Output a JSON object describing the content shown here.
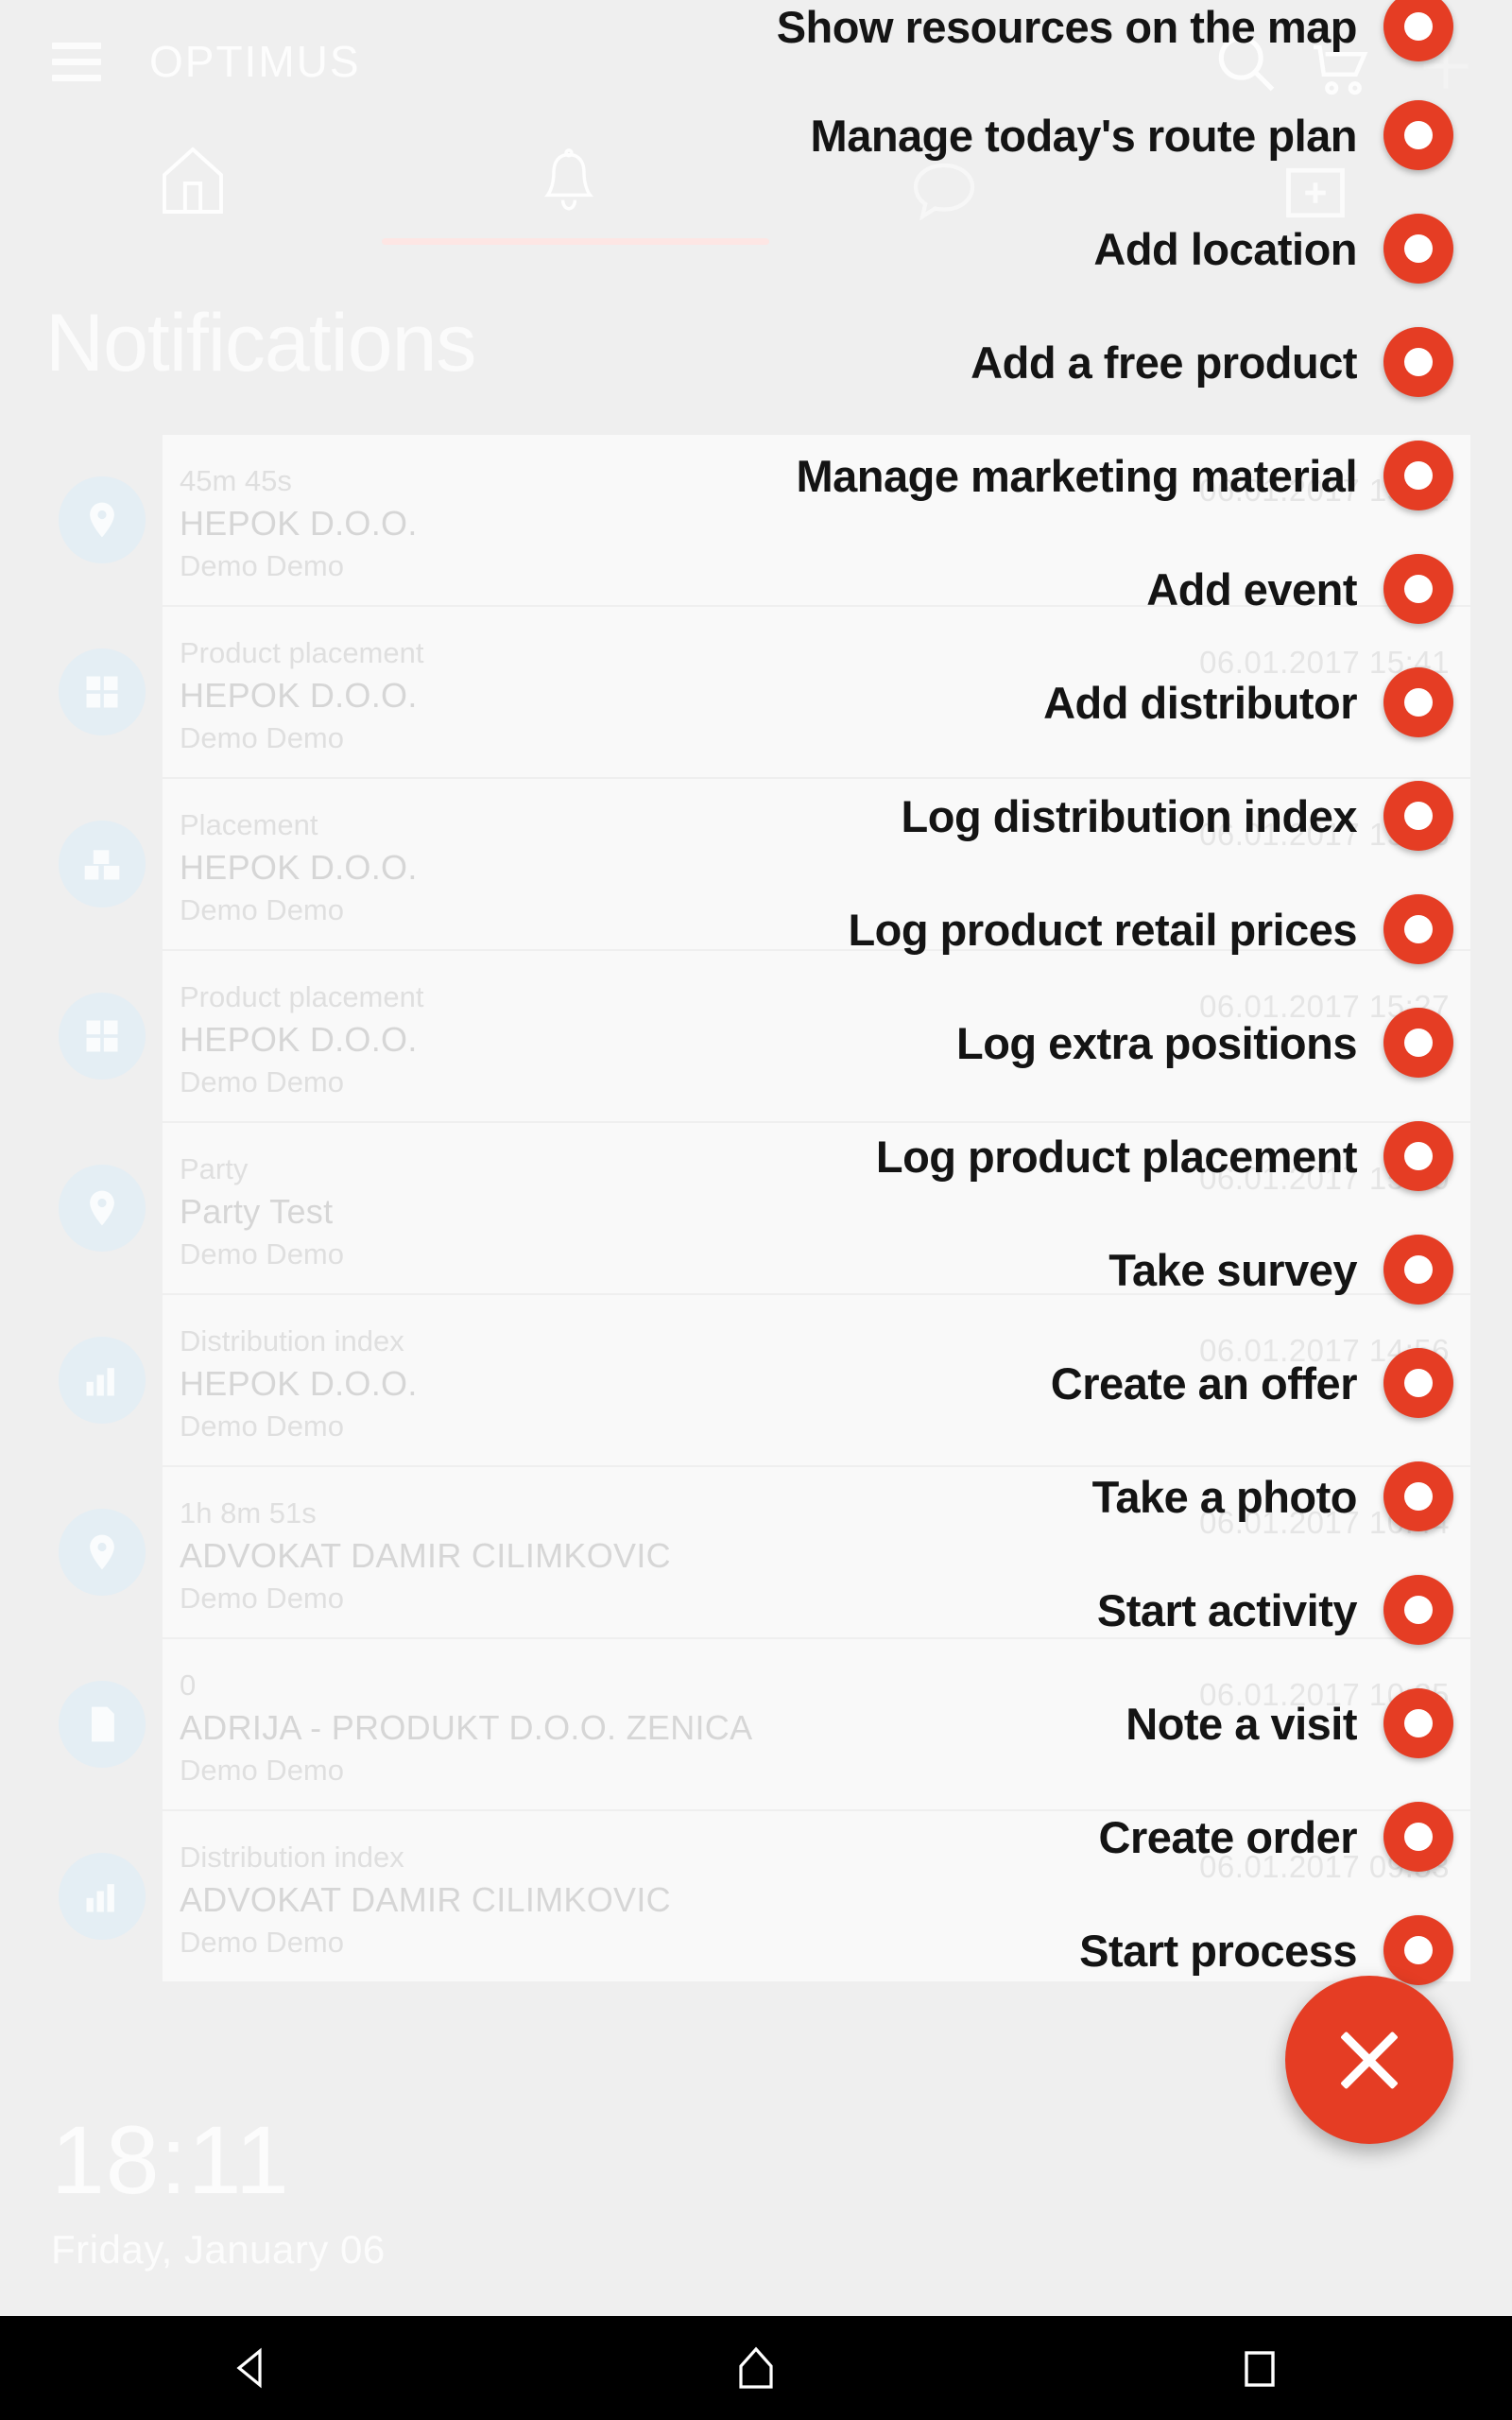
{
  "app": {
    "brand": "OPTIMUS",
    "page_title": "Notifications"
  },
  "appbar": {
    "menu_icon": "hamburger-icon",
    "search_icon": "search-icon",
    "cart_icon": "shopping-cart-icon",
    "add_cart_icon": "add-to-cart-icon"
  },
  "tabs": {
    "home_icon": "home-icon",
    "bell_icon": "bell-icon",
    "chat_icon": "chat-bubble-icon",
    "add_box_icon": "add-box-icon"
  },
  "notifications": [
    {
      "type": "45m 45s",
      "name": "HEPOK D.O.O.",
      "user": "Demo Demo",
      "time": "06.01.2017 15:41",
      "icon": "location-pin-icon"
    },
    {
      "type": "Product placement",
      "name": "HEPOK D.O.O.",
      "user": "Demo Demo",
      "time": "06.01.2017 15:41",
      "icon": "shelf-grid-icon"
    },
    {
      "type": "Placement",
      "name": "HEPOK D.O.O.",
      "user": "Demo Demo",
      "time": "06.01.2017 15:28",
      "icon": "boxes-icon"
    },
    {
      "type": "Product placement",
      "name": "HEPOK D.O.O.",
      "user": "Demo Demo",
      "time": "06.01.2017 15:27",
      "icon": "shelf-grid-icon"
    },
    {
      "type": "Party",
      "name": " Party Test",
      "user": "Demo Demo",
      "time": "06.01.2017 15:00",
      "icon": "location-pin-icon"
    },
    {
      "type": "Distribution index",
      "name": "HEPOK D.O.O.",
      "user": "Demo Demo",
      "time": "06.01.2017 14:56",
      "icon": "bar-chart-icon"
    },
    {
      "type": "1h 8m 51s",
      "name": "ADVOKAT DAMIR CILIMKOVIC",
      "user": "Demo Demo",
      "time": "06.01.2017 10:44",
      "icon": "location-pin-icon"
    },
    {
      "type": "0",
      "name": "ADRIJA - PRODUKT D.O.O. ZENICA",
      "user": "Demo Demo",
      "time": "06.01.2017 10:25",
      "icon": "document-icon"
    },
    {
      "type": "Distribution index",
      "name": "ADVOKAT DAMIR CILIMKOVIC",
      "user": "Demo Demo",
      "time": "06.01.2017 09:53",
      "icon": "bar-chart-icon"
    }
  ],
  "clock": {
    "time": "18:11",
    "date": "Friday, January 06"
  },
  "fab_menu": {
    "close_label": "close-icon",
    "items": [
      {
        "label": "Show resources on the map"
      },
      {
        "label": "Manage today's route plan"
      },
      {
        "label": "Add location"
      },
      {
        "label": "Add a free product"
      },
      {
        "label": "Manage marketing material"
      },
      {
        "label": "Add event"
      },
      {
        "label": "Add distributor"
      },
      {
        "label": "Log distribution index"
      },
      {
        "label": "Log product retail prices"
      },
      {
        "label": "Log extra positions"
      },
      {
        "label": "Log product placement"
      },
      {
        "label": "Take survey"
      },
      {
        "label": "Create an offer"
      },
      {
        "label": "Take a photo"
      },
      {
        "label": "Start activity"
      },
      {
        "label": "Note a visit"
      },
      {
        "label": "Create order"
      },
      {
        "label": "Start process"
      }
    ]
  },
  "navbar": {
    "back": "back-triangle-icon",
    "home": "home-pentagon-icon",
    "recents": "recents-square-icon"
  },
  "colors": {
    "accent_red": "#e53d24",
    "background": "#efefef",
    "card": "#ffffff",
    "navbar": "#000000"
  }
}
